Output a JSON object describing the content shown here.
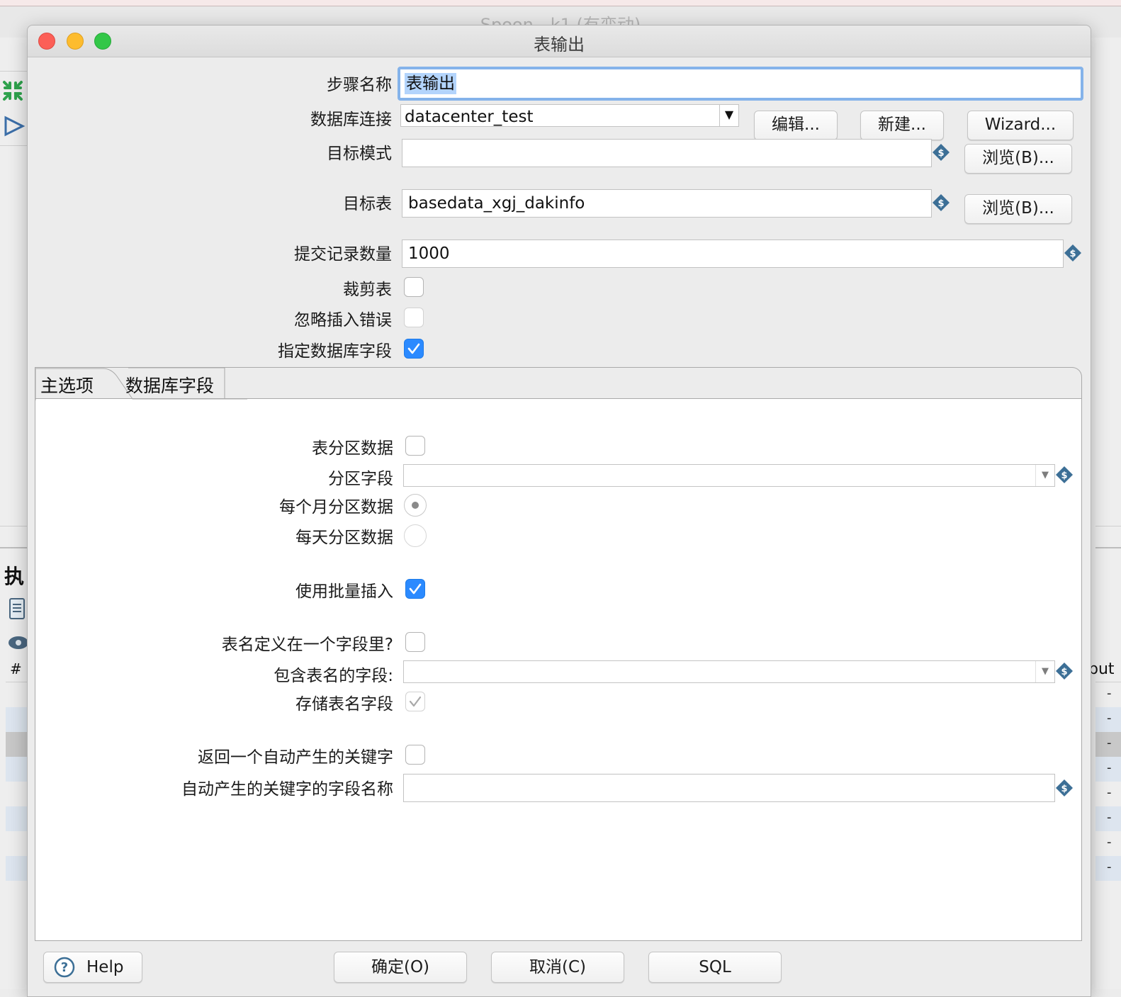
{
  "background": {
    "app_title": "Spoon - k1 (有变动)",
    "left_glyph": "执",
    "hash_header": "#",
    "right_header": "put",
    "row_dash": "-"
  },
  "dialog": {
    "title": "表输出",
    "fields": {
      "step_name_label": "步骤名称",
      "step_name_value": "表输出",
      "db_connection_label": "数据库连接",
      "db_connection_value": "datacenter_test",
      "edit_button": "编辑...",
      "new_button": "新建...",
      "wizard_button": "Wizard...",
      "target_schema_label": "目标模式",
      "target_schema_value": "",
      "browse_schema_button": "浏览(B)...",
      "target_table_label": "目标表",
      "target_table_value": "basedata_xgj_dakinfo",
      "browse_table_button": "浏览(B)...",
      "commit_size_label": "提交记录数量",
      "commit_size_value": "1000",
      "truncate_label": "裁剪表",
      "truncate_checked": false,
      "ignore_errors_label": "忽略插入错误",
      "ignore_errors_checked": false,
      "specify_fields_label": "指定数据库字段",
      "specify_fields_checked": true
    },
    "tabs": [
      {
        "label": "主选项",
        "active": true
      },
      {
        "label": "数据库字段",
        "active": false
      }
    ],
    "main_tab": {
      "partition_label": "表分区数据",
      "partition_checked": false,
      "partition_field_label": "分区字段",
      "partition_field_value": "",
      "monthly_label": "每个月分区数据",
      "monthly_selected": true,
      "daily_label": "每天分区数据",
      "daily_selected": false,
      "batch_insert_label": "使用批量插入",
      "batch_insert_checked": true,
      "name_in_field_label": "表名定义在一个字段里?",
      "name_in_field_checked": false,
      "name_field_label": "包含表名的字段:",
      "name_field_value": "",
      "store_name_label": "存储表名字段",
      "store_name_checked": true,
      "return_key_label": "返回一个自动产生的关键字",
      "return_key_checked": false,
      "key_field_label": "自动产生的关键字的字段名称",
      "key_field_value": ""
    },
    "buttons": {
      "help": "Help",
      "ok": "确定(O)",
      "cancel": "取消(C)",
      "sql": "SQL"
    }
  },
  "colors": {
    "accent": "#2b8aff",
    "close": "#fc5f57",
    "minimize": "#fdbc2e",
    "zoom": "#33c748",
    "variable_icon": "#3c6f96"
  },
  "icons": {
    "variable": "dollar-diamond",
    "help": "question-circle"
  }
}
